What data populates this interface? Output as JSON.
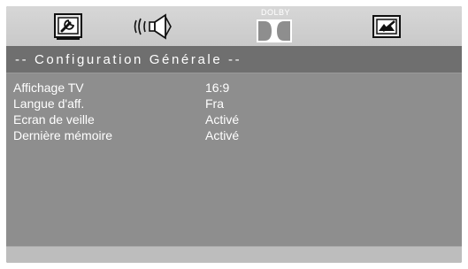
{
  "tabs": {
    "system": {
      "icon": "system-setup-icon"
    },
    "audio": {
      "icon": "speaker-audio-icon"
    },
    "dolby": {
      "label": "DOLBY",
      "icon": "dolby-double-d-icon"
    },
    "video": {
      "icon": "video-setup-icon"
    }
  },
  "header": {
    "title": "-- Configuration Générale --"
  },
  "settings": [
    {
      "label": "Affichage TV",
      "value": "16:9"
    },
    {
      "label": "Langue d'aff.",
      "value": "Fra"
    },
    {
      "label": "Ecran de veille",
      "value": "Activé"
    },
    {
      "label": "Dernière mémoire",
      "value": "Activé"
    }
  ],
  "colors": {
    "panel": "#8e8e8e",
    "tabbar": "#cfcfcf",
    "header": "#6f6f6f",
    "footer": "#bdbdbd",
    "text": "#ffffff"
  }
}
